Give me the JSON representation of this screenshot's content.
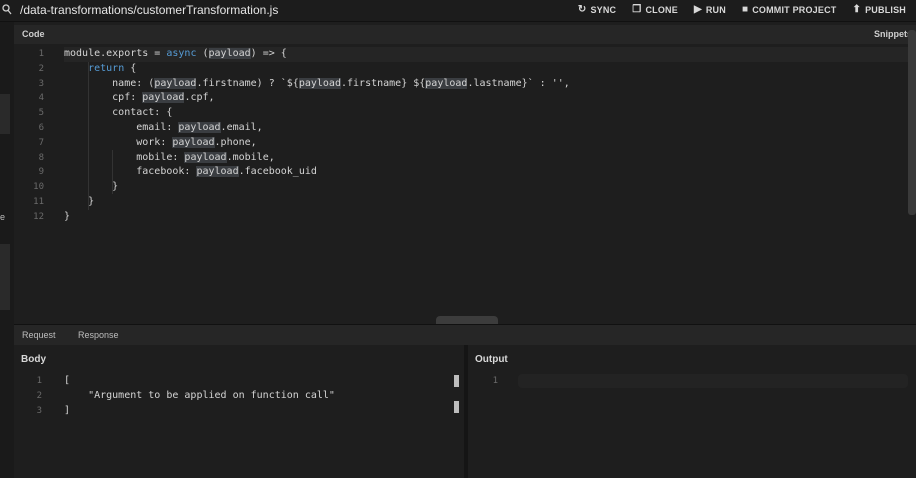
{
  "header": {
    "left_icon": "search-icon",
    "path": "/data-transformations/customerTransformation.js",
    "actions": [
      {
        "label": "SYNC",
        "icon": "sync-icon",
        "glyph": "↻"
      },
      {
        "label": "CLONE",
        "icon": "clone-icon",
        "glyph": "❐"
      },
      {
        "label": "RUN",
        "icon": "play-icon",
        "glyph": "▶"
      },
      {
        "label": "COMMIT PROJECT",
        "icon": "save-icon",
        "glyph": "■"
      },
      {
        "label": "PUBLISH",
        "icon": "publish-icon",
        "glyph": "⬆"
      }
    ]
  },
  "code_panel": {
    "label": "Code",
    "snippets_label": "Snippets",
    "line_numbers": [
      "1",
      "2",
      "3",
      "4",
      "5",
      "6",
      "7",
      "8",
      "9",
      "10",
      "11",
      "12"
    ]
  },
  "sidebar_fragment": "e",
  "tabs": {
    "request": "Request",
    "response": "Response"
  },
  "body_panel": {
    "title": "Body",
    "line_numbers": [
      "1",
      "2",
      "3"
    ],
    "lines": [
      "[",
      "    \"Argument to be applied on function call\"",
      "]"
    ]
  },
  "output_panel": {
    "title": "Output",
    "line_numbers": [
      "1"
    ]
  },
  "colors": {
    "background": "#1e1e1e",
    "keyword": "#569cd6",
    "highlight": "#3a3d41"
  }
}
